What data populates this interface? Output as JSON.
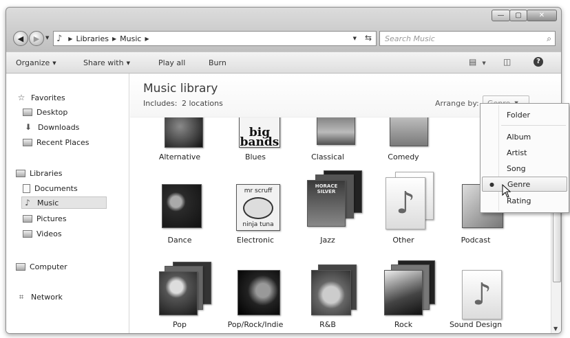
{
  "window": {
    "controls": {
      "minimize": "—",
      "maximize": "▢",
      "close": "✕"
    }
  },
  "address": {
    "back_glyph": "◀",
    "forward_glyph": "▶",
    "crumbs": [
      "Libraries",
      "Music"
    ],
    "separator": "▶",
    "search_placeholder": "Search Music"
  },
  "toolbar": {
    "organize": "Organize",
    "share_with": "Share with",
    "play_all": "Play all",
    "burn": "Burn"
  },
  "nav": {
    "favorites": "Favorites",
    "desktop": "Desktop",
    "downloads": "Downloads",
    "recent_places": "Recent Places",
    "libraries": "Libraries",
    "documents": "Documents",
    "music": "Music",
    "pictures": "Pictures",
    "videos": "Videos",
    "computer": "Computer",
    "network": "Network"
  },
  "library": {
    "title": "Music library",
    "includes": "Includes:",
    "locations_link": "2 locations",
    "arrange_label": "Arrange by:",
    "arrange_value": "Genre"
  },
  "genres": [
    "Alternative",
    "Blues",
    "Classical",
    "Comedy",
    "",
    "Dance",
    "Electronic",
    "Jazz",
    "Other",
    "Podcast",
    "Pop",
    "Pop/Rock/Indie",
    "R&B",
    "Rock",
    "Sound Design"
  ],
  "cover_text": {
    "blues": "big bands",
    "electronic_top": "mr scruff",
    "electronic_bottom": "ninja tuna",
    "jazz": "HORACE SILVER",
    "note": "♪"
  },
  "arrange_menu": {
    "items": [
      "Folder",
      "Album",
      "Artist",
      "Song",
      "Genre",
      "Rating"
    ],
    "selected": "Genre",
    "bullet": "●"
  }
}
